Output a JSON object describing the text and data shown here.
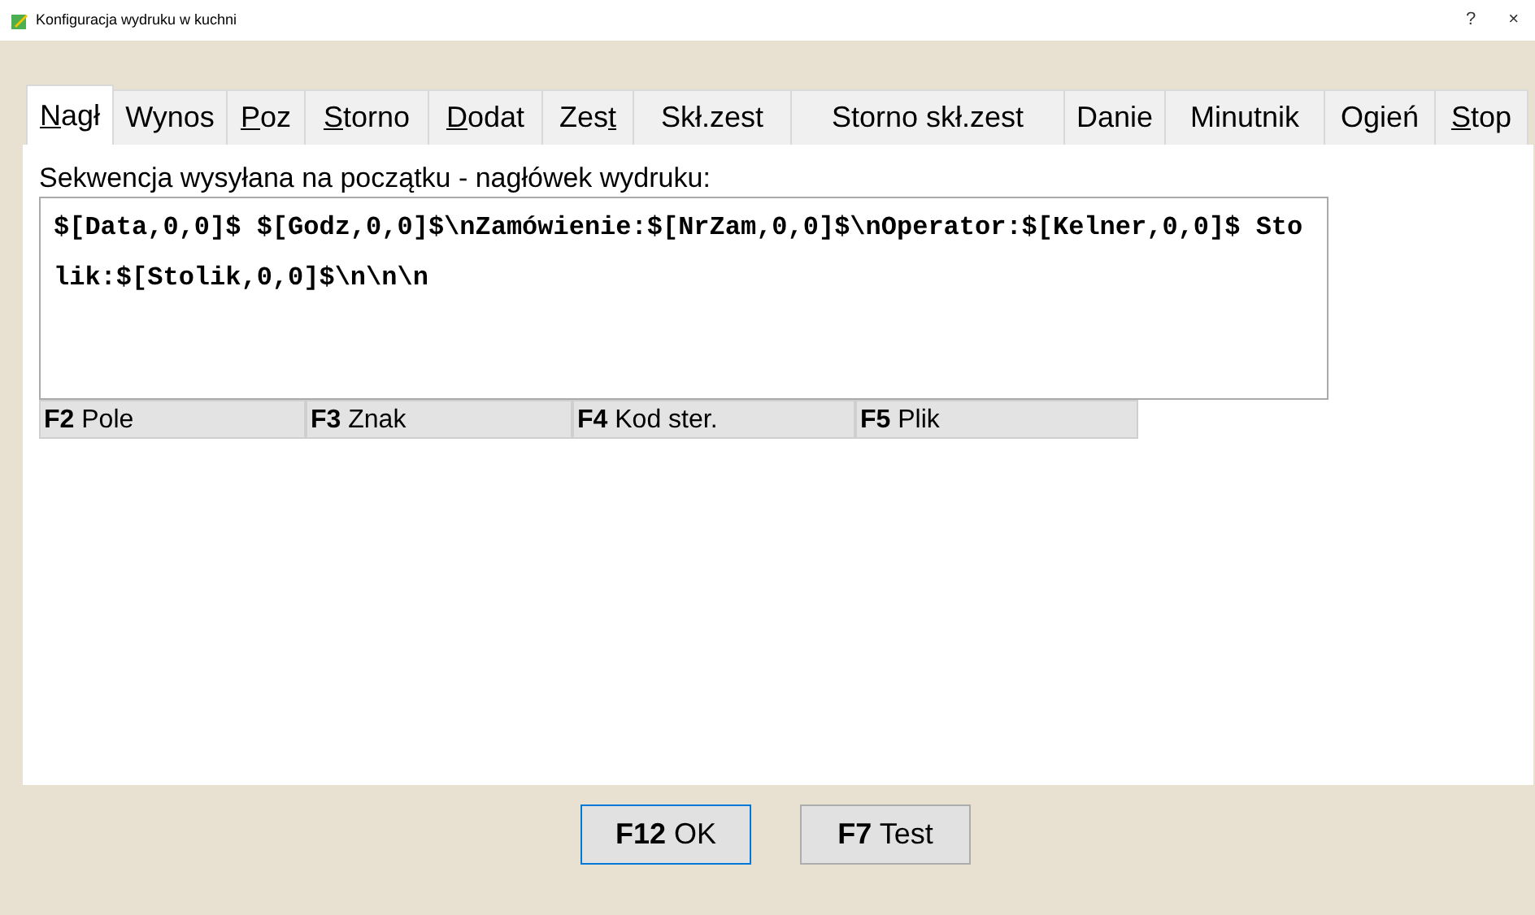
{
  "window": {
    "title": "Konfiguracja wydruku w kuchni",
    "buttons": [
      "?",
      "×"
    ]
  },
  "tabs": [
    {
      "accel": "N",
      "after": "agł",
      "selected": true
    },
    {
      "before": "Wynos",
      "selected": false
    },
    {
      "accel": "P",
      "after": "oz",
      "selected": false
    },
    {
      "accel": "S",
      "after": "torno",
      "selected": false
    },
    {
      "accel": "D",
      "after": "odat",
      "selected": false
    },
    {
      "before": "Zes",
      "accel": "t",
      "selected": false
    },
    {
      "before": "Skł.zest",
      "selected": false
    },
    {
      "before": "Storno skł.zest",
      "selected": false
    },
    {
      "before": "Danie",
      "selected": false
    },
    {
      "before": "Minutnik",
      "selected": false
    },
    {
      "before": "Ogień",
      "selected": false
    },
    {
      "accel": "S",
      "after": "top",
      "selected": false
    }
  ],
  "label": "Sekwencja wysyłana na początku - nagłówek wydruku:",
  "sequence": "$[Data,0,0]$ $[Godz,0,0]$\\nZamówienie:$[NrZam,0,0]$\\nOperator:$[Kelner,0,0]$ Stolik:$[Stolik,0,0]$\\n\\n\\n",
  "insert_buttons": [
    "**F2** Pole",
    "**F3** Znak",
    "**F4** Kod ster.",
    "**F5** Plik"
  ],
  "footer_buttons": [
    {
      "label": "**F12** OK",
      "focused": true
    },
    {
      "label": "**F7** Test",
      "focused": false
    }
  ]
}
